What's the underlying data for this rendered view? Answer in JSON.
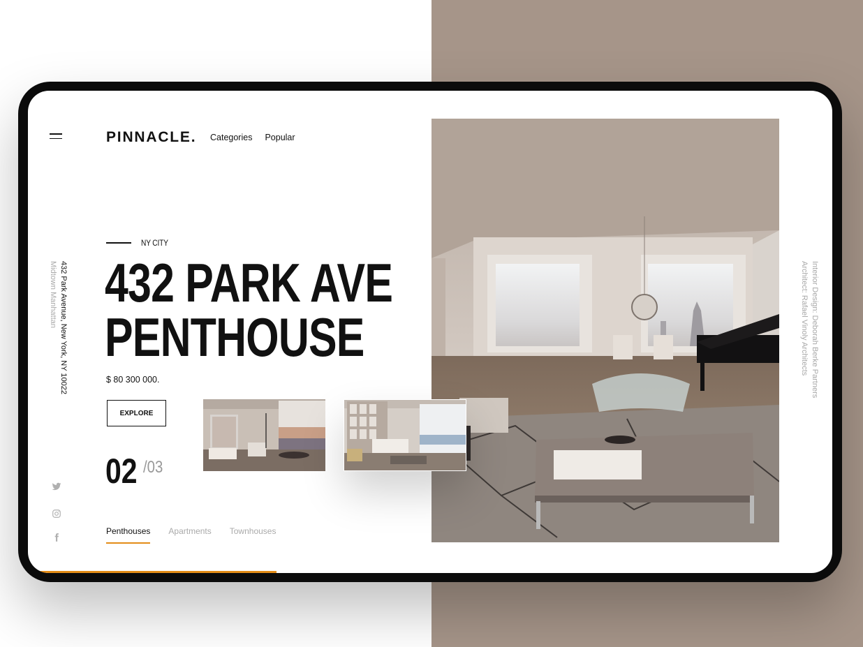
{
  "brand": {
    "name": "PINNACLE."
  },
  "nav": {
    "items": [
      "Categories",
      "Popular"
    ]
  },
  "address": {
    "line1": "432 Park Avenue, New York, NY 10022",
    "line2": "Midtown Manhattan"
  },
  "credits": {
    "line1": "Interior Design: Deborah Berke Partners",
    "line2": "Architect: Rafael Vinoly Architects"
  },
  "listing": {
    "kicker": "NY CITY",
    "title_line1": "432 PARK AVE",
    "title_line2": "PENTHOUSE",
    "price": "$  80 300 000."
  },
  "cta": {
    "explore": "EXPLORE"
  },
  "slider": {
    "current": "02",
    "total": "/03",
    "progress_fraction": 0.31
  },
  "tabs": [
    {
      "label": "Penthouses",
      "active": true
    },
    {
      "label": "Apartments",
      "active": false
    },
    {
      "label": "Townhouses",
      "active": false
    }
  ],
  "social": [
    "twitter-icon",
    "instagram-icon",
    "facebook-icon"
  ],
  "colors": {
    "accent": "#e38c17",
    "backdrop": "#a69589",
    "frame": "#0b0b0b"
  }
}
